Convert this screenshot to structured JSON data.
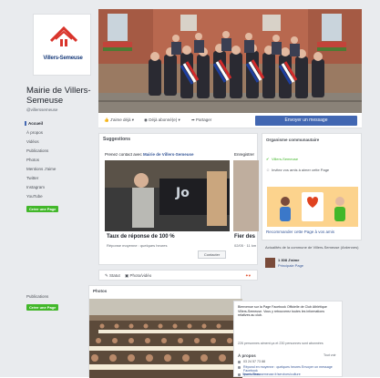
{
  "page": {
    "logo_text": "Villers-Semeuse",
    "name": "Mairie de Villers-Semeuse",
    "handle": "@villerssemeuse"
  },
  "sidebar": {
    "items": [
      {
        "label": "Accueil"
      },
      {
        "label": "À propos"
      },
      {
        "label": "Vidéos"
      },
      {
        "label": "Publications"
      },
      {
        "label": "Photos"
      },
      {
        "label": "Mentions J'aime"
      },
      {
        "label": "Twitter"
      },
      {
        "label": "Instagram"
      },
      {
        "label": "YouTube"
      }
    ],
    "create_page_label": "Créer une Page",
    "publications_label": "Publications",
    "create_page_label_2": "Créer une Page"
  },
  "actions": {
    "like": "J'aime déjà",
    "follow": "Déjà abonné(e)",
    "share": "Partager",
    "send_message": "Envoyer un message"
  },
  "suggestions": {
    "title": "Suggestions",
    "subtitle_prefix": "Prenez contact avec",
    "subtitle_page": "Mairie de Villers-Semeuse",
    "rate_title": "Taux de réponse de 100 %",
    "rate_subtitle": "Réponse moyenne : quelques heures",
    "contact_button": "Contacter",
    "second_title": "Enregistrer",
    "second_rate": "Fier des",
    "second_sub": "02/05 · 11 km"
  },
  "post_bar": {
    "items": [
      "Statut",
      "Photo/vidéo"
    ]
  },
  "photos": {
    "title": "Photos"
  },
  "community": {
    "title": "Organisme communautaire",
    "lines": [
      "Villers-Semeuse",
      "Invitez vos amis à aimer cette Page"
    ],
    "recommend_label": "Recommander cette Page à vos amis"
  },
  "news": {
    "title": "Actualités de la commune de Villers-Semeuse (Ardennes)",
    "likes": "1 308 J'aime",
    "tag": "Principale Page"
  },
  "about": {
    "welcome": "Bienvenue sur la Page Facebook Officielle de Club Athlétique Villers-Semeuse. Vous y retrouverez toutes les informations relatives au club.",
    "people_line": "226 personnes aiment ça et 230 personnes sont abonnées",
    "title": "À propos",
    "see_all": "Tout voir",
    "lines": [
      "03 24 57 73 88",
      "Répond en moyenne : quelques heures Envoyer un message Facebook",
      "www.villers-semeuse.fr/services/culture",
      "Sports Team"
    ]
  },
  "colors": {
    "brand_blue": "#4267b2",
    "link_blue": "#385898",
    "green": "#42b72a",
    "background": "#e9ebee"
  }
}
